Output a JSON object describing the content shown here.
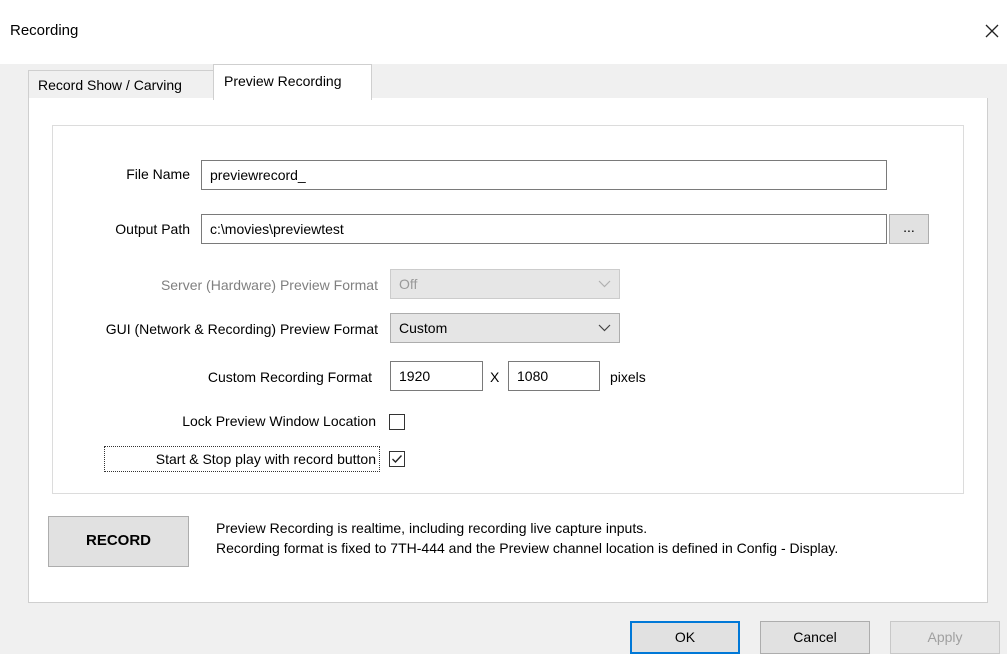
{
  "window": {
    "title": "Recording"
  },
  "tabs": [
    {
      "label": "Record Show / Carving",
      "active": false
    },
    {
      "label": "Preview Recording",
      "active": true
    }
  ],
  "form": {
    "file_name": {
      "label": "File Name",
      "value": "previewrecord_"
    },
    "output_path": {
      "label": "Output Path",
      "value": "c:\\movies\\previewtest",
      "browse_label": "..."
    },
    "server_preview_format": {
      "label": "Server (Hardware) Preview Format",
      "value": "Off",
      "enabled": false
    },
    "gui_preview_format": {
      "label": "GUI (Network & Recording) Preview Format",
      "value": "Custom",
      "enabled": true
    },
    "custom_recording_format": {
      "label": "Custom Recording Format",
      "width": "1920",
      "separator": "X",
      "height": "1080",
      "unit": "pixels"
    },
    "lock_preview_window": {
      "label": "Lock Preview Window Location",
      "checked": false
    },
    "start_stop_with_record": {
      "label": "Start & Stop play with record button",
      "checked": true
    }
  },
  "record_button": {
    "label": "RECORD"
  },
  "info": {
    "line1": "Preview Recording is realtime, including recording live capture inputs.",
    "line2": "Recording format is fixed to 7TH-444 and the Preview channel location is defined in Config - Display."
  },
  "footer": {
    "ok": "OK",
    "cancel": "Cancel",
    "apply": "Apply"
  },
  "colors": {
    "focus_border": "#0078d7",
    "dialog_bg": "#f0f0f0",
    "pane_bg": "#ffffff"
  }
}
